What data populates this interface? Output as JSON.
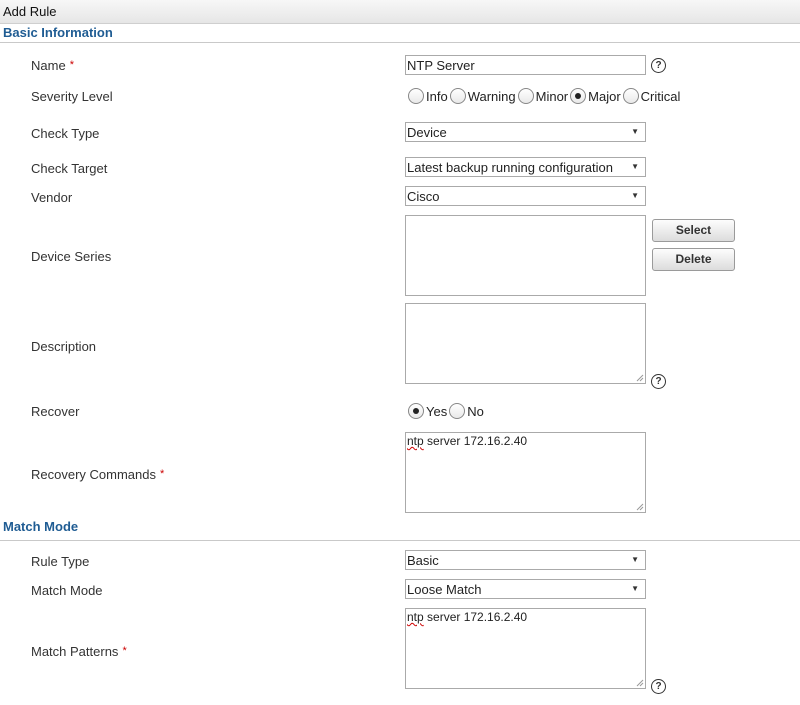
{
  "window": {
    "title": "Add Rule"
  },
  "sections": {
    "basic": "Basic Information",
    "match": "Match Mode"
  },
  "fields": {
    "name": {
      "label": "Name",
      "value": "NTP Server"
    },
    "severity": {
      "label": "Severity Level",
      "options": [
        "Info",
        "Warning",
        "Minor",
        "Major",
        "Critical"
      ],
      "selected": "Major"
    },
    "check_type": {
      "label": "Check Type",
      "value": "Device"
    },
    "check_target": {
      "label": "Check Target",
      "value": "Latest backup running configuration"
    },
    "vendor": {
      "label": "Vendor",
      "value": "Cisco"
    },
    "device_series": {
      "label": "Device Series",
      "value": ""
    },
    "description": {
      "label": "Description",
      "value": ""
    },
    "recover": {
      "label": "Recover",
      "options": [
        "Yes",
        "No"
      ],
      "selected": "Yes"
    },
    "recovery_commands": {
      "label": "Recovery Commands",
      "value_word": "ntp",
      "value_rest": " server 172.16.2.40"
    },
    "rule_type": {
      "label": "Rule Type",
      "value": "Basic"
    },
    "match_mode": {
      "label": "Match Mode",
      "value": "Loose Match"
    },
    "match_patterns": {
      "label": "Match Patterns",
      "value_word": "ntp",
      "value_rest": " server 172.16.2.40"
    }
  },
  "buttons": {
    "select": "Select",
    "delete": "Delete"
  },
  "glyphs": {
    "required": "*",
    "help": "?",
    "dropdown": "▼"
  }
}
